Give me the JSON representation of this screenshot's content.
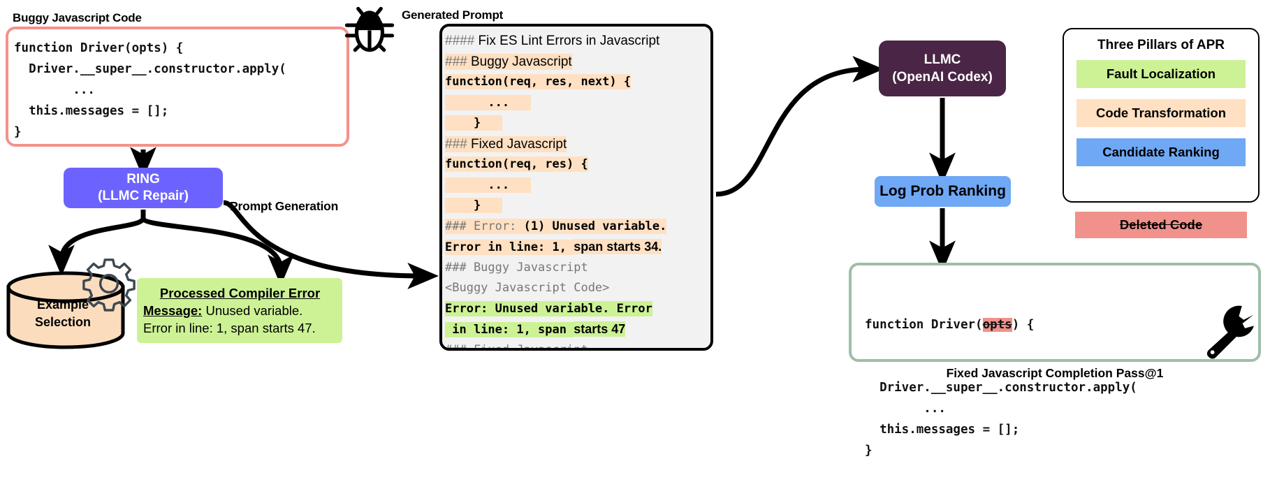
{
  "captions": {
    "buggy_code": "Buggy Javascript Code",
    "generated_prompt": "Generated Prompt",
    "prompt_generation": "Prompt Generation",
    "fixed_completion": "Fixed Javascript Completion Pass@1"
  },
  "icons": {
    "bug": "bug-icon",
    "gear": "gear-icon",
    "wrench": "wrench-icon"
  },
  "buggy_code": {
    "lines": [
      "function Driver(opts) {",
      "  Driver.__super__.constructor.apply(",
      "        ...",
      "  this.messages = [];",
      "}"
    ]
  },
  "ring": {
    "line1": "RING",
    "line2": "(LLMC Repair)"
  },
  "example_selection": {
    "line1": "Example",
    "line2": "Selection"
  },
  "compiler_error": {
    "title_line1": "Processed Compiler Error",
    "title_line2": "Message:",
    "value_line1": " Unused variable.",
    "value_line2": "Error in line: 1, span starts 47."
  },
  "prompt": {
    "lines": [
      {
        "segments": [
          {
            "text": "#### ",
            "style": "sans gray"
          },
          {
            "text": "Fix ES Lint Errors in Javascript",
            "style": "sans"
          }
        ]
      },
      {
        "segments": [
          {
            "text": "### ",
            "style": "sans gray hl-orange"
          },
          {
            "text": "Buggy Javascript",
            "style": "sans hl-orange"
          }
        ]
      },
      {
        "segments": [
          {
            "text": "function(req, res, next) {",
            "style": "monob hl-orange"
          }
        ]
      },
      {
        "segments": [
          {
            "text": "      ...   ",
            "style": "monob hl-orange"
          }
        ]
      },
      {
        "segments": [
          {
            "text": "    }   ",
            "style": "monob hl-orange"
          }
        ]
      },
      {
        "segments": [
          {
            "text": "### ",
            "style": "sans gray hl-orange"
          },
          {
            "text": "Fixed Javascript",
            "style": "sans hl-orange"
          }
        ]
      },
      {
        "segments": [
          {
            "text": "function(req, res) {",
            "style": "monob hl-orange"
          }
        ]
      },
      {
        "segments": [
          {
            "text": "      ...   ",
            "style": "monob hl-orange"
          }
        ]
      },
      {
        "segments": [
          {
            "text": "    }   ",
            "style": "monob hl-orange"
          }
        ]
      },
      {
        "segments": [
          {
            "text": "### ",
            "style": "mono gray hl-orange"
          },
          {
            "text": "Error: ",
            "style": "mono gray hl-orange"
          },
          {
            "text": "(1) Unused variable.",
            "style": "monob hl-orange"
          }
        ]
      },
      {
        "segments": [
          {
            "text": "Error in line: 1, ",
            "style": "monob hl-orange"
          },
          {
            "text": "span starts 34.",
            "style": "sansb hl-orange"
          }
        ]
      },
      {
        "segments": [
          {
            "text": "### Buggy Javascript",
            "style": "mono gray"
          }
        ]
      },
      {
        "segments": [
          {
            "text": "<Buggy Javascript Code>",
            "style": "mono gray"
          }
        ]
      },
      {
        "segments": [
          {
            "text": "Error: Unused variable. Error",
            "style": "monob hl-green"
          }
        ]
      },
      {
        "segments": [
          {
            "text": " in line: 1, span ",
            "style": "monob hl-green"
          },
          {
            "text": "starts 47",
            "style": "sansb hl-green"
          }
        ]
      },
      {
        "segments": [
          {
            "text": "### Fixed Javascript",
            "style": "mono gray"
          }
        ]
      }
    ]
  },
  "llmc": {
    "line1": "LLMC",
    "line2": "(OpenAI Codex)"
  },
  "logprob": {
    "label": "Log Prob Ranking"
  },
  "pillars": {
    "title": "Three Pillars of APR",
    "items": [
      {
        "label": "Fault Localization",
        "color": "#ccf295"
      },
      {
        "label": "Code Transformation",
        "color": "#ffe0c2"
      },
      {
        "label": "Candidate Ranking",
        "color": "#6fa8f5"
      }
    ],
    "deleted_code_label": "Deleted Code",
    "deleted_code_color": "#f0918c"
  },
  "fixed_code": {
    "line1_pre": "function Driver(",
    "line1_strike": "opts",
    "line1_post": ") {",
    "lines_rest": [
      "  Driver.__super__.constructor.apply(",
      "        ...",
      "  this.messages = [];",
      "}"
    ]
  },
  "colors": {
    "ring": "#6c63ff",
    "llmc": "#4a2545",
    "logprob": "#6fa8f5",
    "buggy_border": "#f4918c",
    "fixed_border": "#9dbfa7",
    "highlight_orange": "#ffe0c2",
    "highlight_green": "#ccf295",
    "delete_red": "#f0918c"
  }
}
